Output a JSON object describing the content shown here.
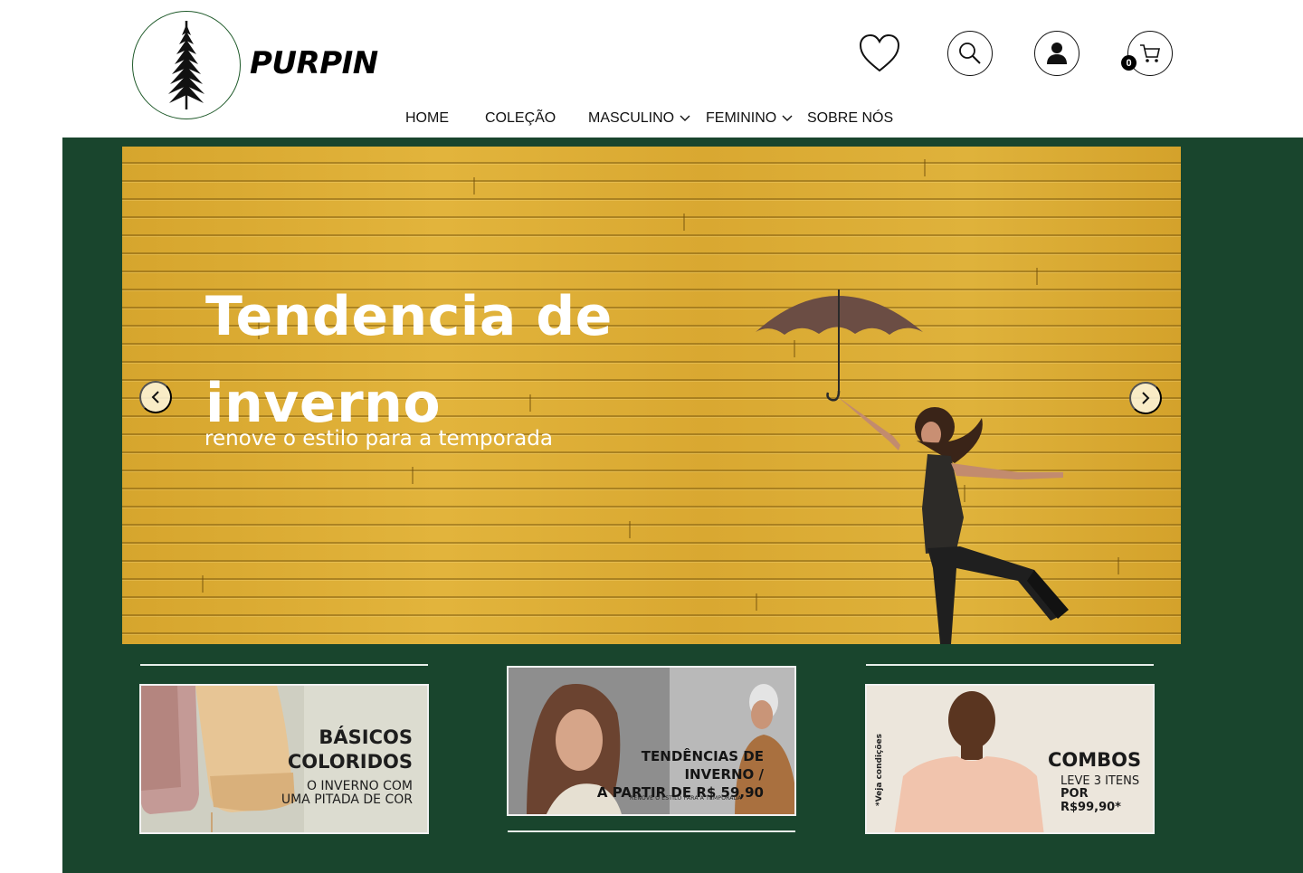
{
  "brand": {
    "name": "PURPIN"
  },
  "header": {
    "cart_count": "0"
  },
  "nav": {
    "items": [
      {
        "label": "HOME"
      },
      {
        "label": "COLEÇÃO"
      },
      {
        "label": "MASCULINO",
        "has_dropdown": true
      },
      {
        "label": "FEMININO",
        "has_dropdown": true
      },
      {
        "label": "SOBRE NÓS"
      }
    ]
  },
  "hero": {
    "title_line1": "Tendencia de",
    "title_line2": "inverno",
    "subtitle": "renove o estilo para a temporada"
  },
  "cards": [
    {
      "title_line1": "BÁSICOS",
      "title_line2": "COLORIDOS",
      "sub_line1": "O INVERNO COM",
      "sub_line2": "UMA PITADA DE COR"
    },
    {
      "title_line1": "TENDÊNCIAS DE INVERNO /",
      "title_line2": "A PARTIR DE R$ 59,90",
      "small": "RENOVE O ESTILO PARA A TEMPORADA"
    },
    {
      "title": "COMBOS",
      "sub_line1": "LEVE 3 ITENS",
      "sub_line2": "POR R$99,90*",
      "note": "*Veja condições"
    }
  ],
  "colors": {
    "brand_green": "#19452d",
    "hero_yellow": "#dcae35",
    "text": "#111111"
  },
  "icons": [
    "heart-icon",
    "search-icon",
    "user-icon",
    "cart-icon",
    "chevron-down-icon",
    "chevron-left-icon",
    "chevron-right-icon",
    "pine-tree-logo"
  ]
}
